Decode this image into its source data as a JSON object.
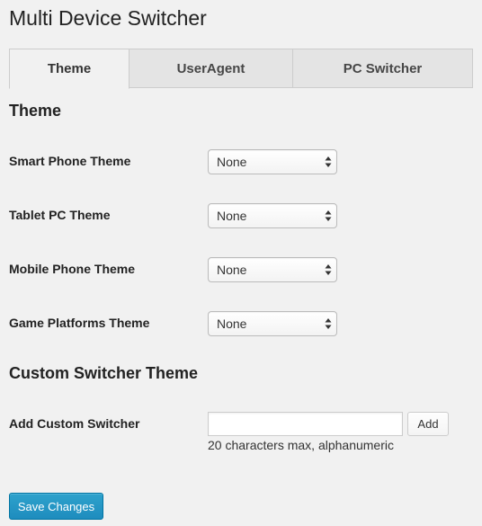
{
  "page": {
    "title": "Multi Device Switcher"
  },
  "tabs": [
    {
      "label": "Theme",
      "active": true
    },
    {
      "label": "UserAgent",
      "active": false
    },
    {
      "label": "PC Switcher",
      "active": false
    }
  ],
  "theme_section": {
    "heading": "Theme",
    "rows": [
      {
        "label": "Smart Phone Theme",
        "value": "None"
      },
      {
        "label": "Tablet PC Theme",
        "value": "None"
      },
      {
        "label": "Mobile Phone Theme",
        "value": "None"
      },
      {
        "label": "Game Platforms Theme",
        "value": "None"
      }
    ]
  },
  "custom_section": {
    "heading": "Custom Switcher Theme",
    "label": "Add Custom Switcher",
    "input_value": "",
    "add_button": "Add",
    "help": "20 characters max, alphanumeric"
  },
  "save_button": "Save Changes",
  "colors": {
    "primary": "#2ea2cc",
    "background": "#f1f1f1"
  },
  "icons": {
    "select_arrow": "up-down-arrows-icon"
  }
}
